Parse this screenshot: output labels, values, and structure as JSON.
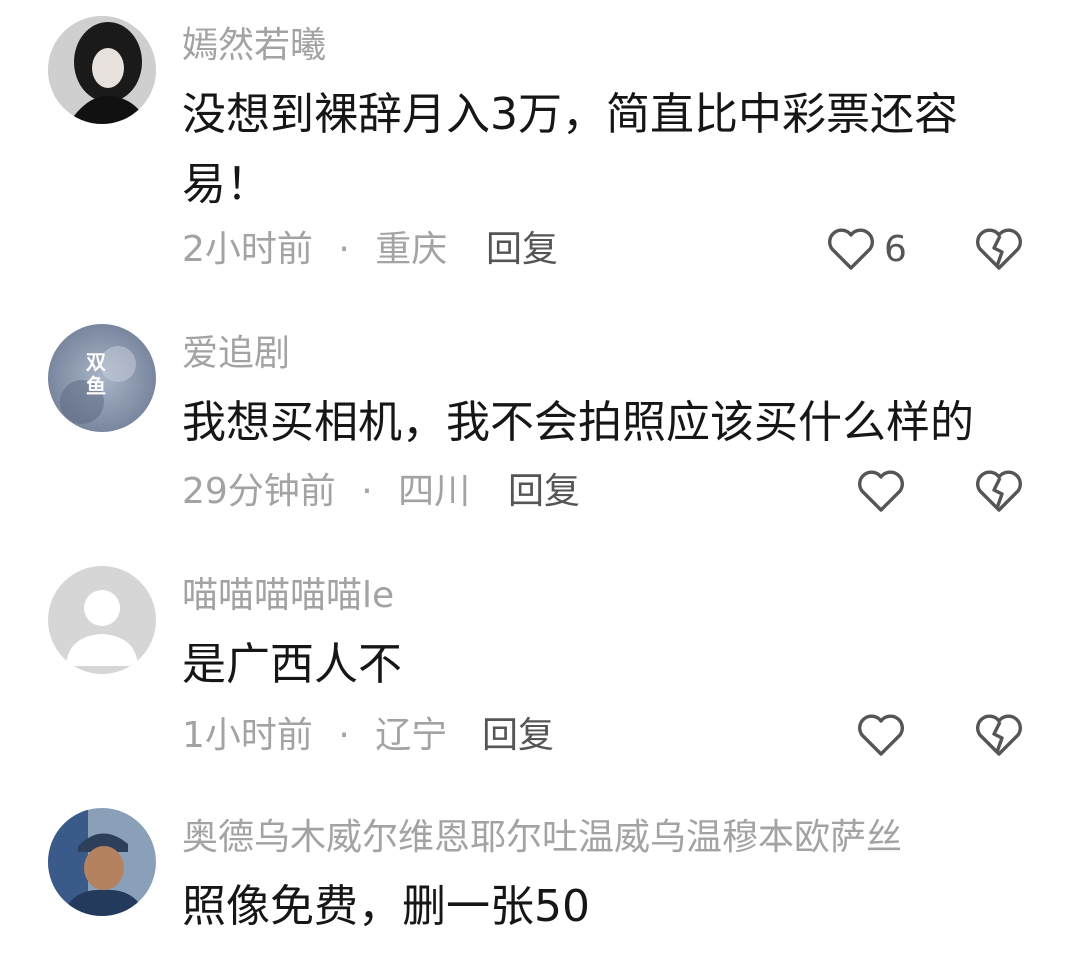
{
  "comments": [
    {
      "username": "嫣然若曦",
      "text": "没想到裸辞月入3万，简直比中彩票还容易！",
      "time": "2小时前",
      "location": "重庆",
      "reply_label": "回复",
      "likes": "6",
      "avatar_icon": "woman-portrait-avatar"
    },
    {
      "username": "爱追剧",
      "text": "我想买相机，我不会拍照应该买什么样的",
      "time": "29分钟前",
      "location": "四川",
      "reply_label": "回复",
      "likes": "",
      "avatar_text": "双鱼",
      "avatar_icon": "pisces-avatar"
    },
    {
      "username": "喵喵喵喵喵le",
      "text": "是广西人不",
      "time": "1小时前",
      "location": "辽宁",
      "reply_label": "回复",
      "likes": "",
      "avatar_icon": "default-user-avatar"
    },
    {
      "username": "奥德乌木威尔维恩耶尔吐温威乌温穆本欧萨丝",
      "text": "照像免费，删一张50",
      "time": "",
      "location": "",
      "reply_label": "",
      "likes": "",
      "avatar_icon": "old-man-portrait-avatar"
    }
  ],
  "separator": "·",
  "colors": {
    "secondary_text": "#a3a3a3",
    "primary_text": "#161616",
    "reply_text": "#555555",
    "icon_stroke": "#555555"
  }
}
